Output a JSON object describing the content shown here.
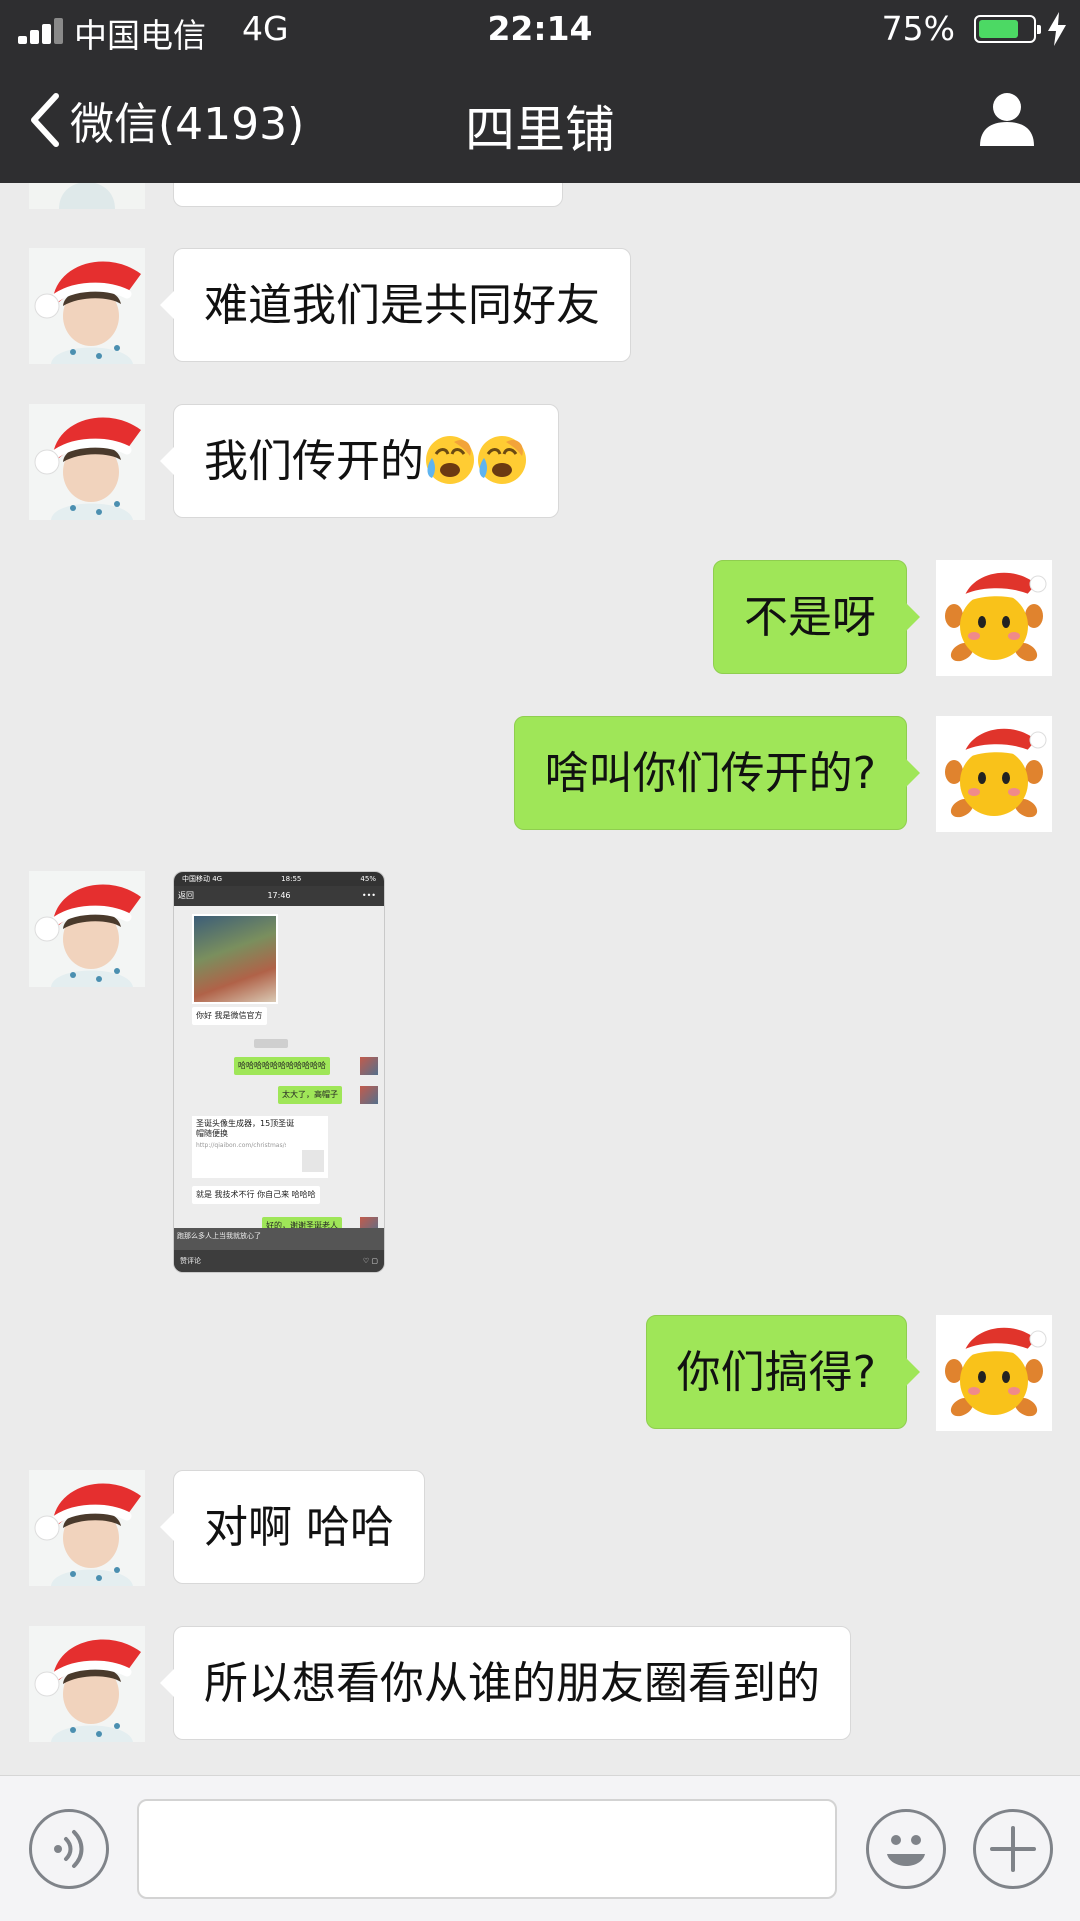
{
  "status_bar": {
    "carrier": "中国电信",
    "network": "4G",
    "time": "22:14",
    "battery_percent_text": "75%",
    "battery_level": 0.75
  },
  "nav": {
    "back_label": "微信(4193)",
    "title": "四里铺",
    "profile_icon": "person-icon"
  },
  "messages": [
    {
      "side": "in",
      "text": "难道我们是共同好友"
    },
    {
      "side": "in",
      "text": "我们传开的",
      "emoji": [
        "face-with-tears-icon",
        "face-with-tears-icon"
      ]
    },
    {
      "side": "out",
      "text": "不是呀"
    },
    {
      "side": "out",
      "text": "啥叫你们传开的?"
    },
    {
      "side": "in",
      "type": "image"
    },
    {
      "side": "out",
      "text": "你们搞得?"
    },
    {
      "side": "in",
      "text": "对啊 哈哈"
    },
    {
      "side": "in",
      "text": "所以想看你从谁的朋友圈看到的"
    }
  ],
  "screenshot_image": {
    "status_carrier": "中国移动 4G",
    "status_time": "18:55",
    "status_battery": "45%",
    "nav_back": "返回",
    "nav_time": "17:46",
    "nav_more": "•••",
    "msg_official": "你好 我是微信官方",
    "msg_haha": "哈哈哈哈哈哈哈哈哈哈哈",
    "msg_big": "太大了，高帽子",
    "link_title": "圣诞头像生成器，15顶圣诞帽随便换",
    "link_url": "http://qiaibon.com/christmas/src/home/xchris.html",
    "msg_tech": "就是 我技术不行 你自己来 哈哈哈",
    "msg_thanks": "好的，谢谢圣诞老人",
    "caption": "跑那么多人上当我就放心了",
    "bottom_left": "赞",
    "bottom_comment": "评论",
    "bottom_right": "♡ ▢"
  },
  "input_bar": {
    "voice_icon": "voice-icon",
    "emoji_icon": "smiley-icon",
    "plus_icon": "plus-icon",
    "text_value": ""
  },
  "colors": {
    "header_bg": "#2e2e30",
    "chat_bg": "#ebebeb",
    "outgoing_bubble": "#9fe658",
    "incoming_bubble": "#ffffff"
  }
}
